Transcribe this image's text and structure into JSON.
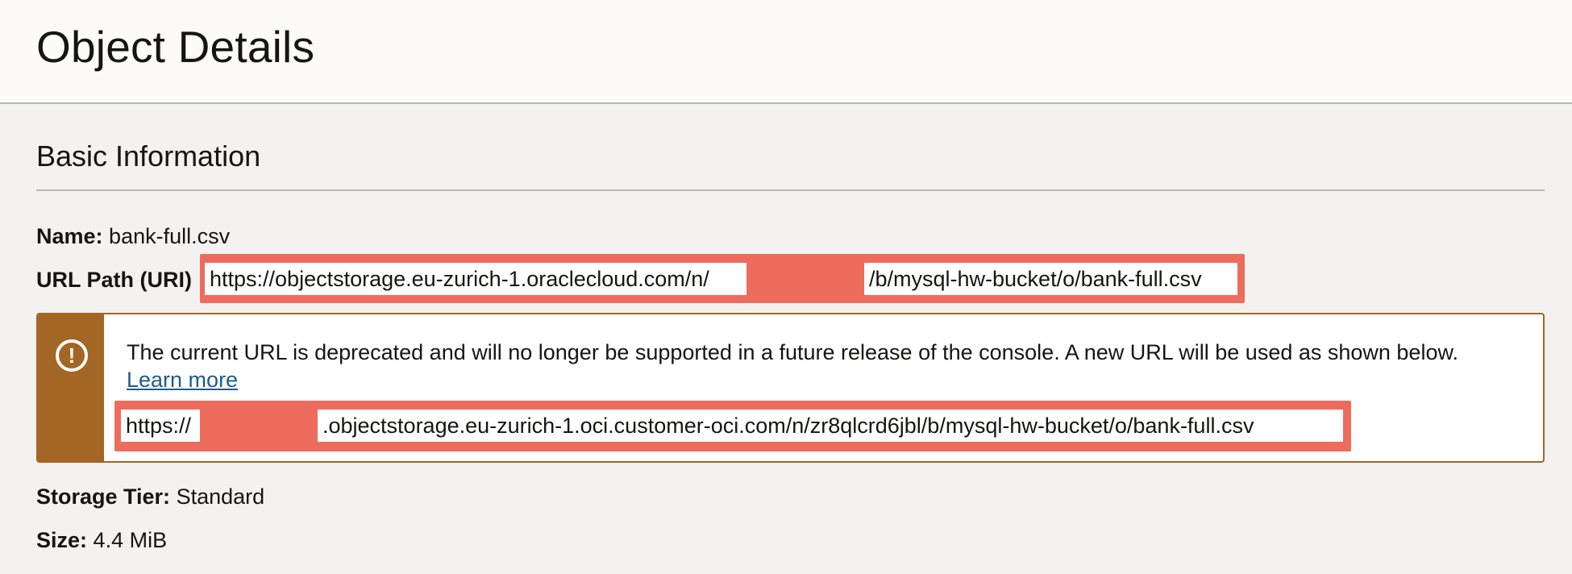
{
  "header": {
    "title": "Object Details"
  },
  "section": {
    "title": "Basic Information"
  },
  "fields": {
    "name_label": "Name:",
    "name_value": "bank-full.csv",
    "uri_label": "URL Path (URI)",
    "uri_part1": "https://objectstorage.eu-zurich-1.oraclecloud.com/n/",
    "uri_part2": "/b/mysql-hw-bucket/o/bank-full.csv",
    "storage_tier_label": "Storage Tier:",
    "storage_tier_value": "Standard",
    "size_label": "Size:",
    "size_value": "4.4 MiB"
  },
  "notice": {
    "icon": "exclamation-circle-icon",
    "message": "The current URL is deprecated and will no longer be supported in a future release of the console. A new URL will be used as shown below.",
    "link_label": "Learn more",
    "new_url_part1": "https://",
    "new_url_part2": ".objectstorage.eu-zurich-1.oci.customer-oci.com/n/zr8qlcrd6jbl/b/mysql-hw-bucket/o/bank-full.csv"
  },
  "colors": {
    "warning": "#a36625",
    "redaction": "#ee6c5d",
    "link": "#1f5b8a"
  }
}
